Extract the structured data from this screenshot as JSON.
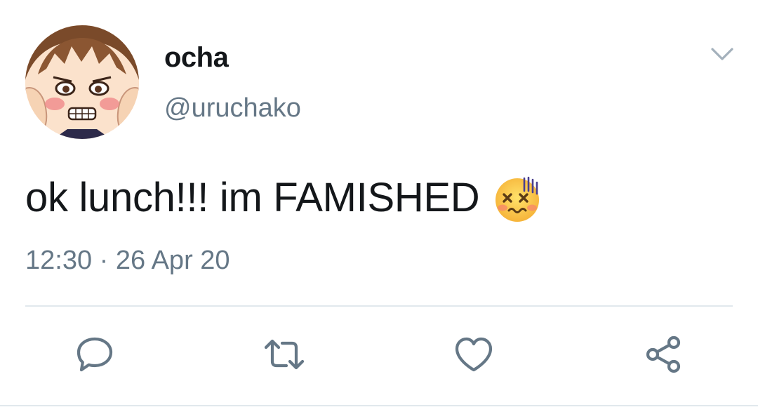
{
  "tweet": {
    "display_name": "ocha",
    "handle": "@uruchako",
    "text": "ok lunch!!! im FAMISHED",
    "emoji": "dizzy-face-icon",
    "timestamp": "12:30 · 26 Apr 20"
  },
  "actions": {
    "reply": "reply-icon",
    "retweet": "retweet-icon",
    "like": "heart-icon",
    "share": "share-icon"
  },
  "colors": {
    "text_primary": "#14171a",
    "text_secondary": "#657786",
    "icon": "#657786",
    "divider": "#e1e8ed"
  }
}
